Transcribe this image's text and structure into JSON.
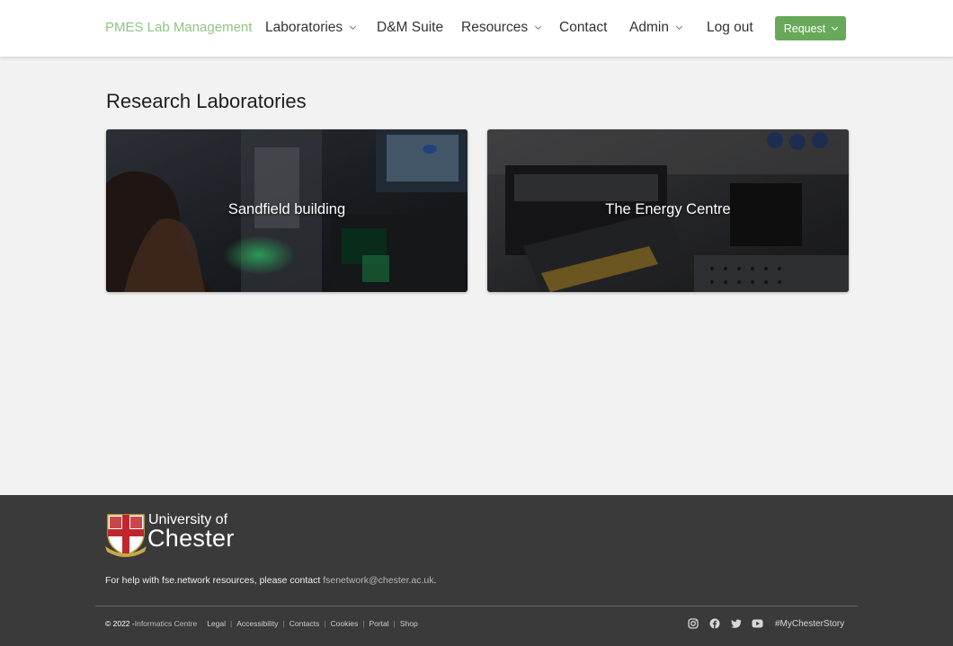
{
  "navbar": {
    "brand": "PMES Lab Management",
    "items": [
      {
        "label": "Laboratories",
        "dropdown": true
      },
      {
        "label": "D&M Suite",
        "dropdown": false
      },
      {
        "label": "Resources",
        "dropdown": true
      },
      {
        "label": "Contact",
        "dropdown": false
      },
      {
        "label": "Admin",
        "dropdown": true
      },
      {
        "label": "Log out",
        "dropdown": false
      }
    ],
    "request_label": "Request"
  },
  "main": {
    "title": "Research Laboratories",
    "cards": [
      {
        "label": "Sandfield building"
      },
      {
        "label": "The Energy Centre"
      }
    ]
  },
  "footer": {
    "logo": {
      "line1": "University of",
      "line2": "Chester"
    },
    "help_text": "For help with fse.network resources, please contact ",
    "help_email": "fsenetwork@chester.ac.uk",
    "help_suffix": ".",
    "copyright": "© 2022 - ",
    "org": "Informatics Centre",
    "links": [
      "Legal",
      "Accessibility",
      "Contacts",
      "Cookies",
      "Portal",
      "Shop"
    ],
    "social_icons": [
      "instagram-icon",
      "facebook-icon",
      "twitter-icon",
      "youtube-icon"
    ],
    "hashtag": "#MyChesterStory"
  },
  "colors": {
    "brand": "#8fc582",
    "request_button": "#67a85a",
    "footer_bg": "#3a3a3a",
    "page_bg": "#f2f2f2"
  }
}
